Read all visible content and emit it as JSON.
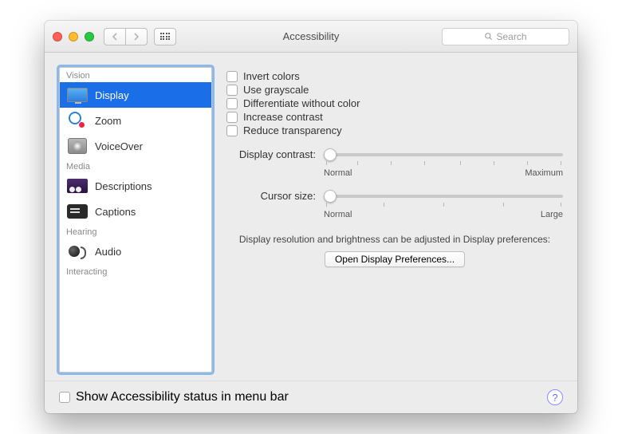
{
  "window": {
    "title": "Accessibility"
  },
  "search": {
    "placeholder": "Search"
  },
  "sidebar": {
    "categories": {
      "vision": "Vision",
      "media": "Media",
      "hearing": "Hearing",
      "interacting": "Interacting"
    },
    "items": {
      "display": "Display",
      "zoom": "Zoom",
      "voiceover": "VoiceOver",
      "descriptions": "Descriptions",
      "captions": "Captions",
      "audio": "Audio"
    }
  },
  "checkboxes": {
    "invert": "Invert colors",
    "grayscale": "Use grayscale",
    "diff": "Differentiate without color",
    "contrast": "Increase contrast",
    "transparency": "Reduce transparency"
  },
  "sliders": {
    "contrast": {
      "label": "Display contrast:",
      "min": "Normal",
      "max": "Maximum"
    },
    "cursor": {
      "label": "Cursor size:",
      "min": "Normal",
      "max": "Large"
    }
  },
  "hint": "Display resolution and brightness can be adjusted in Display preferences:",
  "open_button": "Open Display Preferences...",
  "footer": {
    "menubar": "Show Accessibility status in menu bar"
  }
}
